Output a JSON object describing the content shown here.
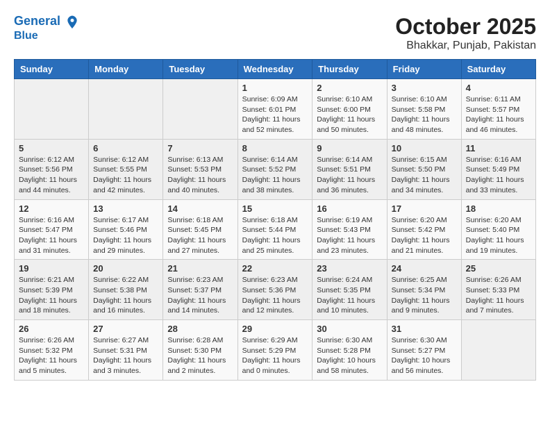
{
  "header": {
    "logo_line1": "General",
    "logo_line2": "Blue",
    "month": "October 2025",
    "location": "Bhakkar, Punjab, Pakistan"
  },
  "weekdays": [
    "Sunday",
    "Monday",
    "Tuesday",
    "Wednesday",
    "Thursday",
    "Friday",
    "Saturday"
  ],
  "weeks": [
    [
      {
        "day": "",
        "sunrise": "",
        "sunset": "",
        "daylight": ""
      },
      {
        "day": "",
        "sunrise": "",
        "sunset": "",
        "daylight": ""
      },
      {
        "day": "",
        "sunrise": "",
        "sunset": "",
        "daylight": ""
      },
      {
        "day": "1",
        "sunrise": "Sunrise: 6:09 AM",
        "sunset": "Sunset: 6:01 PM",
        "daylight": "Daylight: 11 hours and 52 minutes."
      },
      {
        "day": "2",
        "sunrise": "Sunrise: 6:10 AM",
        "sunset": "Sunset: 6:00 PM",
        "daylight": "Daylight: 11 hours and 50 minutes."
      },
      {
        "day": "3",
        "sunrise": "Sunrise: 6:10 AM",
        "sunset": "Sunset: 5:58 PM",
        "daylight": "Daylight: 11 hours and 48 minutes."
      },
      {
        "day": "4",
        "sunrise": "Sunrise: 6:11 AM",
        "sunset": "Sunset: 5:57 PM",
        "daylight": "Daylight: 11 hours and 46 minutes."
      }
    ],
    [
      {
        "day": "5",
        "sunrise": "Sunrise: 6:12 AM",
        "sunset": "Sunset: 5:56 PM",
        "daylight": "Daylight: 11 hours and 44 minutes."
      },
      {
        "day": "6",
        "sunrise": "Sunrise: 6:12 AM",
        "sunset": "Sunset: 5:55 PM",
        "daylight": "Daylight: 11 hours and 42 minutes."
      },
      {
        "day": "7",
        "sunrise": "Sunrise: 6:13 AM",
        "sunset": "Sunset: 5:53 PM",
        "daylight": "Daylight: 11 hours and 40 minutes."
      },
      {
        "day": "8",
        "sunrise": "Sunrise: 6:14 AM",
        "sunset": "Sunset: 5:52 PM",
        "daylight": "Daylight: 11 hours and 38 minutes."
      },
      {
        "day": "9",
        "sunrise": "Sunrise: 6:14 AM",
        "sunset": "Sunset: 5:51 PM",
        "daylight": "Daylight: 11 hours and 36 minutes."
      },
      {
        "day": "10",
        "sunrise": "Sunrise: 6:15 AM",
        "sunset": "Sunset: 5:50 PM",
        "daylight": "Daylight: 11 hours and 34 minutes."
      },
      {
        "day": "11",
        "sunrise": "Sunrise: 6:16 AM",
        "sunset": "Sunset: 5:49 PM",
        "daylight": "Daylight: 11 hours and 33 minutes."
      }
    ],
    [
      {
        "day": "12",
        "sunrise": "Sunrise: 6:16 AM",
        "sunset": "Sunset: 5:47 PM",
        "daylight": "Daylight: 11 hours and 31 minutes."
      },
      {
        "day": "13",
        "sunrise": "Sunrise: 6:17 AM",
        "sunset": "Sunset: 5:46 PM",
        "daylight": "Daylight: 11 hours and 29 minutes."
      },
      {
        "day": "14",
        "sunrise": "Sunrise: 6:18 AM",
        "sunset": "Sunset: 5:45 PM",
        "daylight": "Daylight: 11 hours and 27 minutes."
      },
      {
        "day": "15",
        "sunrise": "Sunrise: 6:18 AM",
        "sunset": "Sunset: 5:44 PM",
        "daylight": "Daylight: 11 hours and 25 minutes."
      },
      {
        "day": "16",
        "sunrise": "Sunrise: 6:19 AM",
        "sunset": "Sunset: 5:43 PM",
        "daylight": "Daylight: 11 hours and 23 minutes."
      },
      {
        "day": "17",
        "sunrise": "Sunrise: 6:20 AM",
        "sunset": "Sunset: 5:42 PM",
        "daylight": "Daylight: 11 hours and 21 minutes."
      },
      {
        "day": "18",
        "sunrise": "Sunrise: 6:20 AM",
        "sunset": "Sunset: 5:40 PM",
        "daylight": "Daylight: 11 hours and 19 minutes."
      }
    ],
    [
      {
        "day": "19",
        "sunrise": "Sunrise: 6:21 AM",
        "sunset": "Sunset: 5:39 PM",
        "daylight": "Daylight: 11 hours and 18 minutes."
      },
      {
        "day": "20",
        "sunrise": "Sunrise: 6:22 AM",
        "sunset": "Sunset: 5:38 PM",
        "daylight": "Daylight: 11 hours and 16 minutes."
      },
      {
        "day": "21",
        "sunrise": "Sunrise: 6:23 AM",
        "sunset": "Sunset: 5:37 PM",
        "daylight": "Daylight: 11 hours and 14 minutes."
      },
      {
        "day": "22",
        "sunrise": "Sunrise: 6:23 AM",
        "sunset": "Sunset: 5:36 PM",
        "daylight": "Daylight: 11 hours and 12 minutes."
      },
      {
        "day": "23",
        "sunrise": "Sunrise: 6:24 AM",
        "sunset": "Sunset: 5:35 PM",
        "daylight": "Daylight: 11 hours and 10 minutes."
      },
      {
        "day": "24",
        "sunrise": "Sunrise: 6:25 AM",
        "sunset": "Sunset: 5:34 PM",
        "daylight": "Daylight: 11 hours and 9 minutes."
      },
      {
        "day": "25",
        "sunrise": "Sunrise: 6:26 AM",
        "sunset": "Sunset: 5:33 PM",
        "daylight": "Daylight: 11 hours and 7 minutes."
      }
    ],
    [
      {
        "day": "26",
        "sunrise": "Sunrise: 6:26 AM",
        "sunset": "Sunset: 5:32 PM",
        "daylight": "Daylight: 11 hours and 5 minutes."
      },
      {
        "day": "27",
        "sunrise": "Sunrise: 6:27 AM",
        "sunset": "Sunset: 5:31 PM",
        "daylight": "Daylight: 11 hours and 3 minutes."
      },
      {
        "day": "28",
        "sunrise": "Sunrise: 6:28 AM",
        "sunset": "Sunset: 5:30 PM",
        "daylight": "Daylight: 11 hours and 2 minutes."
      },
      {
        "day": "29",
        "sunrise": "Sunrise: 6:29 AM",
        "sunset": "Sunset: 5:29 PM",
        "daylight": "Daylight: 11 hours and 0 minutes."
      },
      {
        "day": "30",
        "sunrise": "Sunrise: 6:30 AM",
        "sunset": "Sunset: 5:28 PM",
        "daylight": "Daylight: 10 hours and 58 minutes."
      },
      {
        "day": "31",
        "sunrise": "Sunrise: 6:30 AM",
        "sunset": "Sunset: 5:27 PM",
        "daylight": "Daylight: 10 hours and 56 minutes."
      },
      {
        "day": "",
        "sunrise": "",
        "sunset": "",
        "daylight": ""
      }
    ]
  ]
}
